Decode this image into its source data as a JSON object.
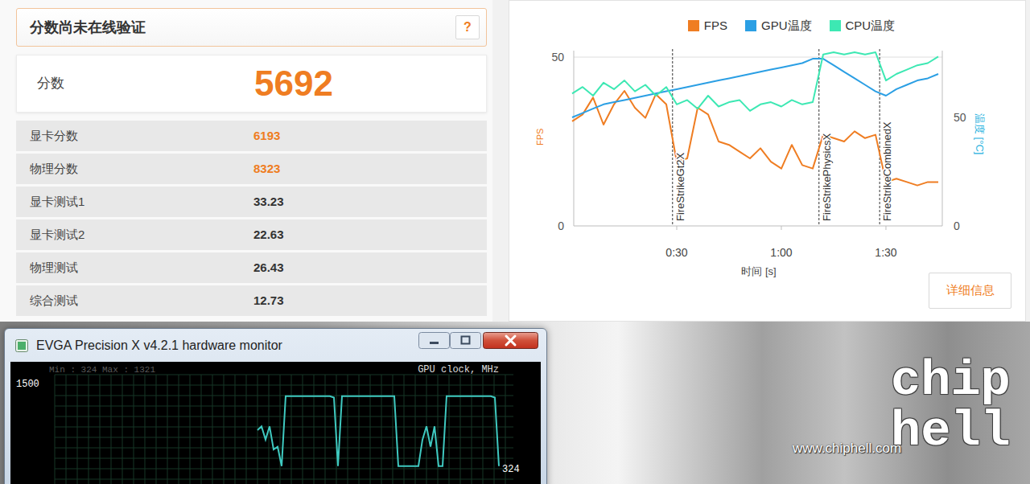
{
  "validation": {
    "message": "分数尚未在线验证",
    "help": "?"
  },
  "score": {
    "label": "分数",
    "value": "5692"
  },
  "details": [
    {
      "label": "显卡分数",
      "value": "6193",
      "highlight": true
    },
    {
      "label": "物理分数",
      "value": "8323",
      "highlight": true
    },
    {
      "label": "显卡测试1",
      "value": "33.23",
      "highlight": false
    },
    {
      "label": "显卡测试2",
      "value": "22.63",
      "highlight": false
    },
    {
      "label": "物理测试",
      "value": "26.43",
      "highlight": false
    },
    {
      "label": "综合测试",
      "value": "12.73",
      "highlight": false
    }
  ],
  "chart": {
    "fps_axis": {
      "title": "FPS",
      "ticks": [
        "50",
        "0"
      ]
    },
    "temp_axis": {
      "title": "温度 [°C]",
      "ticks": [
        "50",
        "0"
      ]
    },
    "time_axis": {
      "title": "时间 [s]",
      "ticks": [
        {
          "label": "0:30",
          "time": 30
        },
        {
          "label": "1:00",
          "time": 60
        },
        {
          "label": "1:30",
          "time": 90
        }
      ]
    },
    "markers": [
      {
        "label": "FireStrikeGt2X",
        "time": 28.8
      },
      {
        "label": "FireStrikePhysicsX",
        "time": 70.8
      },
      {
        "label": "FireStrikeCombinedX",
        "time": 88.2
      }
    ],
    "time_s": [
      0,
      3,
      6,
      9,
      12,
      15,
      18,
      21,
      24,
      27,
      30,
      33,
      36,
      39,
      42,
      45,
      48,
      51,
      54,
      57,
      60,
      63,
      66,
      69,
      72,
      75,
      78,
      81,
      84,
      87,
      90,
      93,
      96,
      99,
      102,
      105
    ],
    "series": [
      {
        "name": "FPS",
        "color": "#ef7d22",
        "axis": "fps",
        "values": [
          31,
          33,
          38,
          30,
          36,
          40,
          35,
          32,
          39,
          36,
          19,
          20,
          35,
          33,
          25,
          24,
          22,
          20,
          23,
          19,
          17,
          24,
          18,
          17,
          27,
          26,
          25,
          28,
          26,
          27,
          13,
          14,
          13,
          12,
          13,
          13
        ]
      },
      {
        "name": "GPU温度",
        "color": "#2b9fe4",
        "axis": "temp",
        "values": [
          50,
          52,
          54,
          56,
          57,
          58,
          59,
          60,
          61,
          62,
          63,
          64,
          65,
          66,
          67,
          68,
          69,
          70,
          71,
          72,
          73,
          74,
          75,
          77,
          77,
          74,
          71,
          68,
          65,
          62,
          60,
          63,
          65,
          67,
          68,
          70
        ]
      },
      {
        "name": "CPU温度",
        "color": "#3de8b3",
        "axis": "temp",
        "values": [
          61,
          64,
          60,
          66,
          63,
          67,
          62,
          65,
          60,
          64,
          56,
          58,
          54,
          60,
          55,
          57,
          58,
          53,
          56,
          57,
          55,
          58,
          56,
          57,
          79,
          80,
          79,
          80,
          79,
          80,
          67,
          70,
          72,
          74,
          75,
          78
        ]
      }
    ],
    "details_button": "详细信息"
  },
  "monitor": {
    "title": "EVGA Precision X v4.2.1 hardware monitor",
    "min_max": "Min : 324 Max : 1321",
    "graph_title": "GPU clock, MHz",
    "axis_max": "1500",
    "current": "324",
    "values": [
      836,
      890,
      700,
      890,
      560,
      600,
      324,
      1321,
      1321,
      1321,
      1321,
      1321,
      1321,
      1321,
      1321,
      1321,
      1321,
      1321,
      1321,
      1300,
      324,
      1321,
      1321,
      1321,
      1321,
      1321,
      1321,
      1321,
      1321,
      1321,
      1321,
      1321,
      1321,
      1321,
      1321,
      324,
      324,
      324,
      324,
      324,
      324,
      700,
      890,
      600,
      890,
      324,
      324,
      1321,
      1321,
      1321,
      1321,
      1321,
      1321,
      1321,
      1321,
      1321,
      1321,
      1321,
      1321,
      1300,
      324
    ]
  },
  "watermark": {
    "logo": "chiphell",
    "url": "www.chiphell.com"
  }
}
